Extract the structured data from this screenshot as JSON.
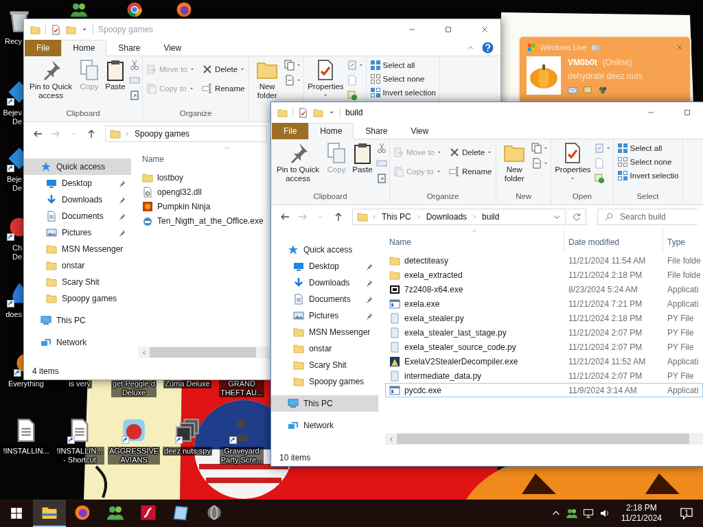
{
  "desktop_icons": [
    {
      "kind": "bin",
      "lines": [
        "Recy"
      ]
    },
    {
      "kind": "people"
    },
    {
      "kind": "browser"
    },
    {
      "kind": "fox"
    },
    {
      "kind": "gem",
      "shortcut": true,
      "lines": [
        "Bejev",
        "De"
      ]
    },
    {
      "kind": "gem",
      "shortcut": true,
      "lines": [
        "Beje",
        "De"
      ]
    },
    {
      "kind": "chip",
      "shortcut": true,
      "lines": [
        "Ch",
        "De"
      ]
    },
    {
      "kind": "flame",
      "shortcut": true,
      "lines": [
        "does"
      ]
    },
    {
      "kind": "orb",
      "shortcut": true,
      "lines": [
        "Everything"
      ]
    },
    {
      "lines": [
        "is very"
      ]
    },
    {
      "lines": [
        "get Peggle d",
        "Deluxe"
      ]
    },
    {
      "lines": [
        "Zuma Deluxe"
      ]
    },
    {
      "lines": [
        "GRAND",
        "THEFT AU..."
      ]
    },
    {
      "kind": "doc",
      "shortcut": false,
      "lines": [
        "!INSTALLIN..."
      ]
    },
    {
      "kind": "doc",
      "shortcut": true,
      "lines": [
        "!INSTALLIN...",
        "- Shortcut"
      ]
    },
    {
      "kind": "bird",
      "shortcut": true,
      "lines": [
        "AGGRESSIVE",
        "AVIANS"
      ]
    },
    {
      "kind": "stack",
      "shortcut": true,
      "lines": [
        "deez nuts spy"
      ]
    },
    {
      "kind": "figure",
      "shortcut": true,
      "lines": [
        "Graveyard",
        "Party Scre..."
      ]
    }
  ],
  "messenger_popup": {
    "title": "Windows Live",
    "user": "VM0b0t",
    "status": "(Online)",
    "message": "dehydrate deez nuts"
  },
  "windows": [
    {
      "title": "Spoopy games",
      "active": false,
      "title_controls": [
        {
          "kind": "minimize"
        },
        {
          "kind": "maximize"
        },
        {
          "kind": "close"
        }
      ],
      "tab_controls": [
        {
          "kind": "collapse"
        },
        {
          "kind": "help"
        }
      ],
      "tabs": [
        {
          "label": "File",
          "kind": "menu",
          "selected": false
        },
        {
          "label": "Home",
          "kind": "tab",
          "selected": true
        },
        {
          "label": "Share",
          "kind": "tab",
          "selected": false
        },
        {
          "label": "View",
          "kind": "tab",
          "selected": false
        }
      ],
      "ribbon": [
        {
          "kind": "clipboard",
          "label": "Clipboard",
          "buttons": [
            {
              "text": "Pin to Quick access",
              "disabled": false
            },
            {
              "text": "Copy",
              "disabled": true
            },
            {
              "text": "Paste",
              "disabled": false
            }
          ]
        },
        {
          "kind": "organize",
          "label": "Organize",
          "buttons": [
            {
              "text": "Move to",
              "disabled": true,
              "dropdown": true
            },
            {
              "text": "Delete",
              "disabled": false,
              "dropdown": true
            },
            {
              "text": "Copy to",
              "disabled": true,
              "dropdown": true
            },
            {
              "text": "Rename",
              "disabled": false,
              "dropdown": false
            }
          ]
        },
        {
          "kind": "new",
          "buttons": [
            {
              "text": "New folder",
              "disabled": false
            }
          ]
        },
        {
          "kind": "open",
          "buttons": [
            {
              "text": "Properties",
              "disabled": false,
              "dropdown": true
            }
          ]
        },
        {
          "kind": "select",
          "buttons": [
            {
              "text": "Select all",
              "disabled": false
            },
            {
              "text": "Select none",
              "disabled": false
            },
            {
              "text": "Invert selection",
              "disabled": false
            }
          ]
        }
      ],
      "address": [
        "Spoopy games"
      ],
      "nav": [
        {
          "label": "Quick access",
          "kind": "star",
          "selected": true,
          "children": [
            {
              "label": "Desktop",
              "kind": "desktop",
              "pinned": true,
              "selected": false
            },
            {
              "label": "Downloads",
              "kind": "download",
              "pinned": true,
              "selected": false
            },
            {
              "label": "Documents",
              "kind": "docs",
              "pinned": true,
              "selected": false
            },
            {
              "label": "Pictures",
              "kind": "pictures",
              "pinned": true,
              "selected": false
            },
            {
              "label": "MSN Messenger",
              "kind": "folder",
              "pinned": false,
              "selected": false
            },
            {
              "label": "onstar",
              "kind": "folder",
              "pinned": false,
              "selected": false
            },
            {
              "label": "Scary Shit",
              "kind": "folder",
              "pinned": false,
              "selected": false
            },
            {
              "label": "Spoopy games",
              "kind": "folder",
              "pinned": false,
              "selected": false
            }
          ]
        },
        {
          "label": "This PC",
          "kind": "pc",
          "selected": false
        },
        {
          "label": "Network",
          "kind": "network",
          "selected": false
        }
      ],
      "columns": [
        "Name"
      ],
      "files": [
        {
          "name": "lostboy",
          "kind": "folder",
          "selected": false
        },
        {
          "name": "opengl32.dll",
          "kind": "dll",
          "selected": false
        },
        {
          "name": "Pumpkin Ninja",
          "kind": "game",
          "selected": false
        },
        {
          "name": "Ten_Nigth_at_the_Office.exe",
          "kind": "engine",
          "selected": false
        }
      ],
      "status": "4 items"
    },
    {
      "title": "build",
      "active": true,
      "title_controls": [
        {
          "kind": "minimize"
        },
        {
          "kind": "maximize"
        }
      ],
      "tabs": [
        {
          "label": "File",
          "kind": "menu",
          "selected": false
        },
        {
          "label": "Home",
          "kind": "tab",
          "selected": true
        },
        {
          "label": "Share",
          "kind": "tab",
          "selected": false
        },
        {
          "label": "View",
          "kind": "tab",
          "selected": false
        }
      ],
      "ribbon": [
        {
          "kind": "clipboard",
          "label": "Clipboard",
          "buttons": [
            {
              "text": "Pin to Quick access",
              "disabled": false
            },
            {
              "text": "Copy",
              "disabled": true
            },
            {
              "text": "Paste",
              "disabled": false
            }
          ]
        },
        {
          "kind": "organize",
          "label": "Organize",
          "buttons": [
            {
              "text": "Move to",
              "disabled": true,
              "dropdown": true
            },
            {
              "text": "Delete",
              "disabled": false,
              "dropdown": true
            },
            {
              "text": "Copy to",
              "disabled": true,
              "dropdown": true
            },
            {
              "text": "Rename",
              "disabled": false,
              "dropdown": false
            }
          ]
        },
        {
          "kind": "new",
          "label": "New",
          "buttons": [
            {
              "text": "New folder",
              "disabled": false
            }
          ]
        },
        {
          "kind": "open",
          "label": "Open",
          "buttons": [
            {
              "text": "Properties",
              "disabled": false,
              "dropdown": true
            }
          ]
        },
        {
          "kind": "select",
          "label": "Select",
          "buttons": [
            {
              "text": "Select all",
              "disabled": false
            },
            {
              "text": "Select none",
              "disabled": false
            },
            {
              "text": "Invert selectio",
              "disabled": false
            }
          ]
        }
      ],
      "address": [
        "This PC",
        "Downloads",
        "build"
      ],
      "search": {
        "placeholder": "Search build"
      },
      "nav": [
        {
          "label": "Quick access",
          "kind": "star",
          "selected": false,
          "children": [
            {
              "label": "Desktop",
              "kind": "desktop",
              "pinned": true,
              "selected": false
            },
            {
              "label": "Downloads",
              "kind": "download",
              "pinned": true,
              "selected": false
            },
            {
              "label": "Documents",
              "kind": "docs",
              "pinned": true,
              "selected": false
            },
            {
              "label": "Pictures",
              "kind": "pictures",
              "pinned": true,
              "selected": false
            },
            {
              "label": "MSN Messenger",
              "kind": "folder",
              "pinned": false,
              "selected": false
            },
            {
              "label": "onstar",
              "kind": "folder",
              "pinned": false,
              "selected": false
            },
            {
              "label": "Scary Shit",
              "kind": "folder",
              "pinned": false,
              "selected": false
            },
            {
              "label": "Spoopy games",
              "kind": "folder",
              "pinned": false,
              "selected": false
            }
          ]
        },
        {
          "label": "This PC",
          "kind": "pc",
          "selected": true
        },
        {
          "label": "Network",
          "kind": "network",
          "selected": false
        }
      ],
      "columns": [
        "Name",
        "Date modified",
        "Type"
      ],
      "files": [
        {
          "name": "detectiteasy",
          "kind": "folder",
          "date": "11/21/2024 11:54 AM",
          "type": "File folde",
          "selected": false
        },
        {
          "name": "exela_extracted",
          "kind": "folder",
          "date": "11/21/2024 2:18 PM",
          "type": "File folde",
          "selected": false
        },
        {
          "name": "7z2408-x64.exe",
          "kind": "archive",
          "date": "8/23/2024 5:24 AM",
          "type": "Applicati",
          "selected": false
        },
        {
          "name": "exela.exe",
          "kind": "app",
          "date": "11/21/2024 7:21 PM",
          "type": "Applicati",
          "selected": false
        },
        {
          "name": "exela_stealer.py",
          "kind": "py",
          "date": "11/21/2024 2:18 PM",
          "type": "PY File",
          "selected": false
        },
        {
          "name": "exela_stealer_last_stage.py",
          "kind": "py",
          "date": "11/21/2024 2:07 PM",
          "type": "PY File",
          "selected": false
        },
        {
          "name": "exela_stealer_source_code.py",
          "kind": "py",
          "date": "11/21/2024 2:07 PM",
          "type": "PY File",
          "selected": false
        },
        {
          "name": "ExelaV2StealerDecompiler.exe",
          "kind": "tool",
          "date": "11/21/2024 11:52 AM",
          "type": "Applicati",
          "selected": false
        },
        {
          "name": "intermediate_data.py",
          "kind": "py",
          "date": "11/21/2024 2:07 PM",
          "type": "PY File",
          "selected": false
        },
        {
          "name": "pycdc.exe",
          "kind": "app",
          "date": "11/9/2024 3:14 AM",
          "type": "Applicati",
          "selected": true
        }
      ],
      "status": "10 items"
    }
  ],
  "taskbar": {
    "apps": [
      {
        "kind": "explorer",
        "active": true
      },
      {
        "kind": "fox",
        "active": false
      },
      {
        "kind": "people",
        "active": false
      },
      {
        "kind": "flash",
        "active": false
      },
      {
        "kind": "notepad",
        "active": false
      },
      {
        "kind": "globe",
        "active": false
      }
    ],
    "time": "2:18 PM",
    "date": "11/21/2024",
    "notifications": "1"
  }
}
